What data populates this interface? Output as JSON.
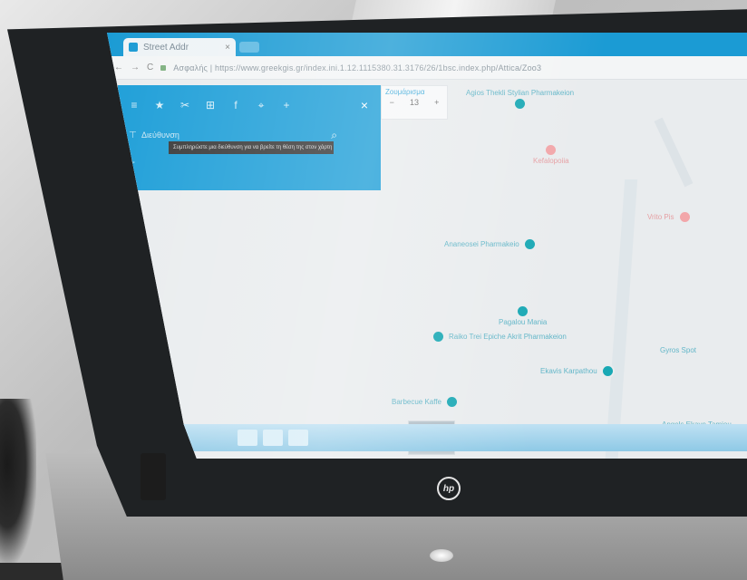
{
  "browser": {
    "tab_title": "Street Addr",
    "tab_close": "×",
    "nav": {
      "back": "←",
      "forward": "→",
      "reload": "C"
    },
    "url": "Ασφαλής | https://www.greekgis.gr/index.ini.1.12.1115380.31.3176/26/1bsc.index.php/Attica/Zoo3"
  },
  "map": {
    "toolbar_icons": [
      "menu-icon",
      "star-icon",
      "measure-icon",
      "layers-icon",
      "facebook-icon",
      "route-icon",
      "plus-icon"
    ],
    "toolbar_glyphs": [
      "≡",
      "★",
      "✂",
      "⊞",
      "f",
      "⌖",
      "+"
    ],
    "close_glyph": "×",
    "search_placeholder": "Διεύθυνση",
    "search_marker": "⊤",
    "add_marker": "+",
    "search_glyph": "⌕",
    "tooltip": "Συμπληρώστε μια διεύθυνση για να βρείτε τη θέση της στον χάρτη",
    "zoom": {
      "label": "Ζουμάρισμα",
      "minus": "−",
      "level": "13",
      "plus": "+"
    },
    "poi": [
      {
        "label": "Agios Thekli Stylian Pharmakeion",
        "color": "teal"
      },
      {
        "label": "Kefalopoiia",
        "color": "red"
      },
      {
        "label": "Ananeosei Pharmakeio",
        "color": "teal"
      },
      {
        "label": "Pagalou Mania",
        "color": "teal"
      },
      {
        "label": "Ekavis Karpathou",
        "color": "teal"
      },
      {
        "label": "Raiko Trei Epiche Akrit Pharmakeion",
        "color": "teal"
      },
      {
        "label": "Barbecue Kaffe",
        "color": "teal"
      },
      {
        "label": "Gyros Spot",
        "color": "teal"
      },
      {
        "label": "Vrito Pis",
        "color": "red"
      },
      {
        "label": "Angels Ekave Tamiou",
        "color": "teal"
      }
    ]
  },
  "device": {
    "brand": "hp"
  },
  "colors": {
    "panel": "#1f9fd8",
    "tabstrip": "#1b9bd4",
    "pin_teal": "#19a8b4",
    "pin_red": "#f2a6a9"
  }
}
